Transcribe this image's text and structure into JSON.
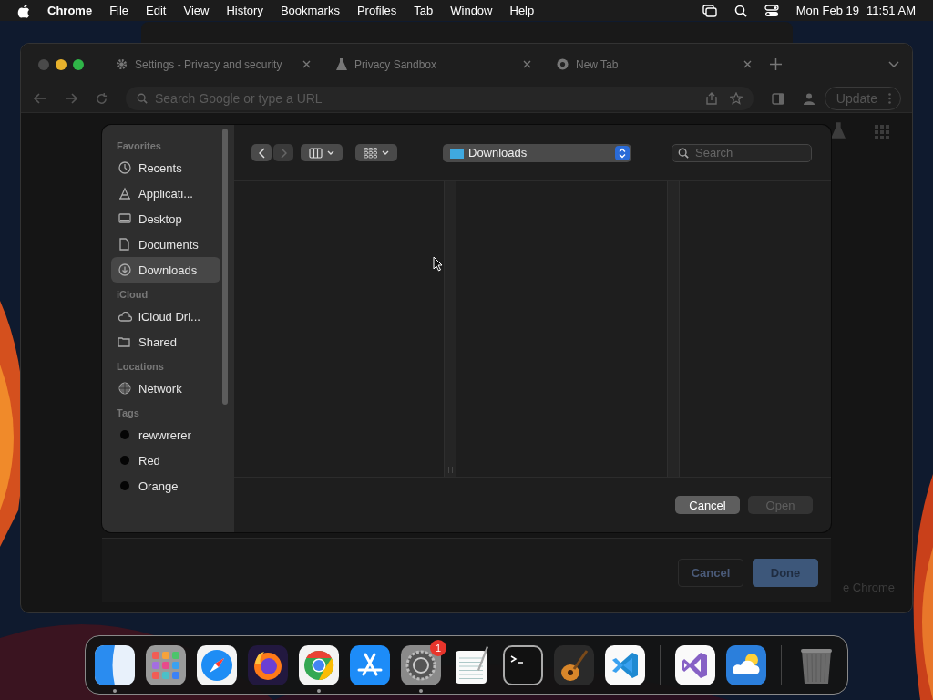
{
  "menu_bar": {
    "app": "Chrome",
    "menus": [
      "File",
      "Edit",
      "View",
      "History",
      "Bookmarks",
      "Profiles",
      "Tab",
      "Window",
      "Help"
    ],
    "date": "Mon Feb 19",
    "time": "11:51 AM"
  },
  "browser": {
    "tabs": [
      {
        "label": "Settings - Privacy and security",
        "kind": "gear"
      },
      {
        "label": "Privacy Sandbox",
        "kind": "flask"
      },
      {
        "label": "New Tab",
        "kind": "chrome"
      }
    ],
    "address_bar": {
      "placeholder": "Search Google or type a URL"
    },
    "update_button": "Update",
    "settings_dialog": {
      "buttons": [
        {
          "label": "Cancel",
          "kind": "secondary"
        },
        {
          "label": "Done",
          "kind": "primary"
        }
      ],
      "page_text": "e Chrome"
    }
  },
  "open_dialog": {
    "location": "Downloads",
    "search": {
      "placeholder": "Search"
    },
    "back_disabled": false,
    "forward_disabled": true,
    "sidebar": [
      {
        "heading": "Favorites",
        "items": [
          {
            "label": "Recents",
            "kind": "clock",
            "selected": false
          },
          {
            "label": "Applicati...",
            "kind": "apps",
            "selected": false
          },
          {
            "label": "Desktop",
            "kind": "desktop",
            "selected": false
          },
          {
            "label": "Documents",
            "kind": "document",
            "selected": false
          },
          {
            "label": "Downloads",
            "kind": "download",
            "selected": true
          }
        ]
      },
      {
        "heading": "iCloud",
        "items": [
          {
            "label": "iCloud Dri...",
            "kind": "cloud",
            "selected": false
          },
          {
            "label": "Shared",
            "kind": "folder",
            "selected": false
          }
        ]
      },
      {
        "heading": "Locations",
        "items": [
          {
            "label": "Network",
            "kind": "globe",
            "selected": false
          }
        ]
      },
      {
        "heading": "Tags",
        "items": [
          {
            "label": "rewwrerer",
            "kind": "tag",
            "selected": false
          },
          {
            "label": "Red",
            "kind": "tag",
            "selected": false
          },
          {
            "label": "Orange",
            "kind": "tag",
            "selected": false
          }
        ]
      }
    ],
    "buttons": [
      {
        "label": "Cancel",
        "disabled": false
      },
      {
        "label": "Open",
        "disabled": true
      }
    ]
  },
  "dock": [
    {
      "kind": "finder",
      "running": true
    },
    {
      "kind": "launchpad",
      "running": false
    },
    {
      "kind": "compass",
      "running": false
    },
    {
      "kind": "fox",
      "running": false
    },
    {
      "kind": "chrome",
      "running": true
    },
    {
      "kind": "store",
      "running": false
    },
    {
      "kind": "gear",
      "running": true,
      "badge": "1"
    },
    {
      "kind": "notepad",
      "running": false
    },
    {
      "kind": "terminal",
      "running": false
    },
    {
      "kind": "guitar",
      "running": false
    },
    {
      "kind": "code",
      "running": false
    },
    {
      "kind": "divider"
    },
    {
      "kind": "vs",
      "running": false
    },
    {
      "kind": "weather",
      "running": false
    },
    {
      "kind": "divider"
    },
    {
      "kind": "trash",
      "running": false
    }
  ]
}
